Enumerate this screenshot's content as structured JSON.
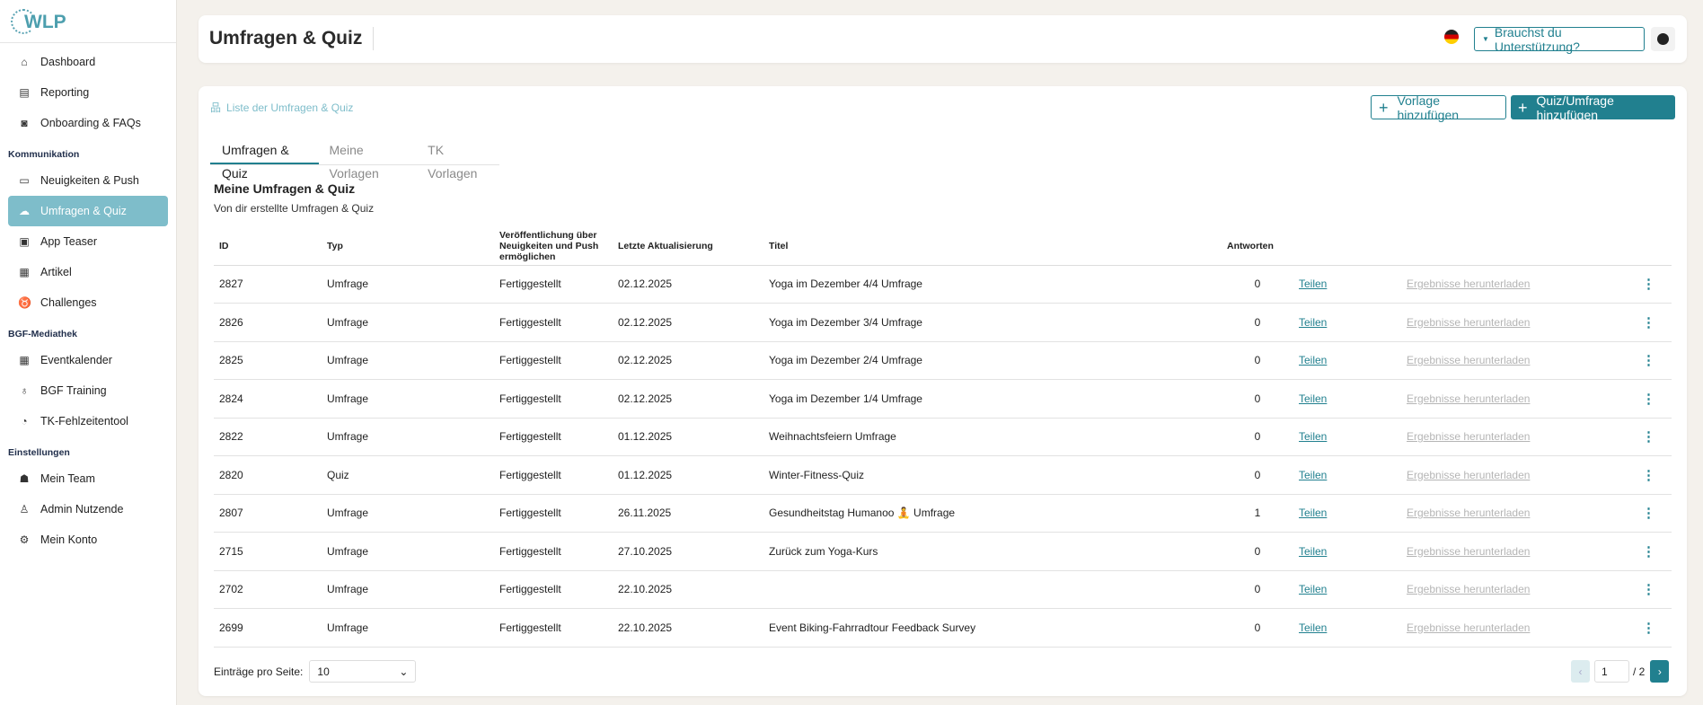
{
  "logo": "WLP",
  "sidebar": {
    "top": [
      {
        "label": "Dashboard",
        "icon": "⌂"
      },
      {
        "label": "Reporting",
        "icon": "▤"
      },
      {
        "label": "Onboarding & FAQs",
        "icon": "◙"
      }
    ],
    "sections": [
      {
        "title": "Kommunikation",
        "items": [
          {
            "label": "Neuigkeiten & Push",
            "icon": "▭"
          },
          {
            "label": "Umfragen & Quiz",
            "icon": "☁",
            "active": true
          },
          {
            "label": "App Teaser",
            "icon": "▣"
          },
          {
            "label": "Artikel",
            "icon": "▦"
          },
          {
            "label": "Challenges",
            "icon": "♉"
          }
        ]
      },
      {
        "title": "BGF-Mediathek",
        "items": [
          {
            "label": "Eventkalender",
            "icon": "▦"
          },
          {
            "label": "BGF Training",
            "icon": "♁"
          },
          {
            "label": "TK-Fehlzeitentool",
            "icon": "◔"
          }
        ]
      },
      {
        "title": "Einstellungen",
        "items": [
          {
            "label": "Mein Team",
            "icon": "☗"
          },
          {
            "label": "Admin Nutzende",
            "icon": "♙"
          },
          {
            "label": "Mein Konto",
            "icon": "⚙"
          }
        ]
      }
    ]
  },
  "header": {
    "title": "Umfragen & Quiz",
    "help_label": "Brauchst du Unterstützung?"
  },
  "main": {
    "breadcrumb": "Liste der Umfragen & Quiz",
    "add_template": "Vorlage hinzufügen",
    "add_quiz": "Quiz/Umfrage hinzufügen",
    "tabs": [
      "Umfragen & Quiz",
      "Meine Vorlagen",
      "TK Vorlagen"
    ],
    "section_title": "Meine Umfragen & Quiz",
    "section_subtitle": "Von dir erstellte Umfragen & Quiz",
    "columns": [
      "ID",
      "Typ",
      "Veröffentlichung über Neuigkeiten und Push ermöglichen",
      "Letzte Aktualisierung",
      "Titel",
      "Antworten"
    ],
    "share_label": "Teilen",
    "download_label": "Ergebnisse herunterladen",
    "rows": [
      {
        "id": "2827",
        "type": "Umfrage",
        "status": "Fertiggestellt",
        "date": "02.12.2025",
        "title": "Yoga im Dezember 4/4 Umfrage",
        "answers": "0"
      },
      {
        "id": "2826",
        "type": "Umfrage",
        "status": "Fertiggestellt",
        "date": "02.12.2025",
        "title": "Yoga im Dezember 3/4 Umfrage",
        "answers": "0"
      },
      {
        "id": "2825",
        "type": "Umfrage",
        "status": "Fertiggestellt",
        "date": "02.12.2025",
        "title": "Yoga im Dezember 2/4 Umfrage",
        "answers": "0"
      },
      {
        "id": "2824",
        "type": "Umfrage",
        "status": "Fertiggestellt",
        "date": "02.12.2025",
        "title": "Yoga im Dezember 1/4 Umfrage",
        "answers": "0"
      },
      {
        "id": "2822",
        "type": "Umfrage",
        "status": "Fertiggestellt",
        "date": "01.12.2025",
        "title": "Weihnachtsfeiern Umfrage",
        "answers": "0"
      },
      {
        "id": "2820",
        "type": "Quiz",
        "status": "Fertiggestellt",
        "date": "01.12.2025",
        "title": "Winter-Fitness-Quiz",
        "answers": "0"
      },
      {
        "id": "2807",
        "type": "Umfrage",
        "status": "Fertiggestellt",
        "date": "26.11.2025",
        "title": "Gesundheitstag Humanoo 🧘 Umfrage",
        "answers": "1"
      },
      {
        "id": "2715",
        "type": "Umfrage",
        "status": "Fertiggestellt",
        "date": "27.10.2025",
        "title": "Zurück zum Yoga-Kurs",
        "answers": "0"
      },
      {
        "id": "2702",
        "type": "Umfrage",
        "status": "Fertiggestellt",
        "date": "22.10.2025",
        "title": "",
        "answers": "0"
      },
      {
        "id": "2699",
        "type": "Umfrage",
        "status": "Fertiggestellt",
        "date": "22.10.2025",
        "title": "Event Biking-Fahrradtour Feedback Survey",
        "answers": "0"
      }
    ],
    "per_page_label": "Einträge pro Seite:",
    "per_page_value": "10",
    "page": "1",
    "page_total": "/ 2"
  },
  "colors": {
    "accent": "#21808f",
    "active_nav": "#7ebdca"
  }
}
